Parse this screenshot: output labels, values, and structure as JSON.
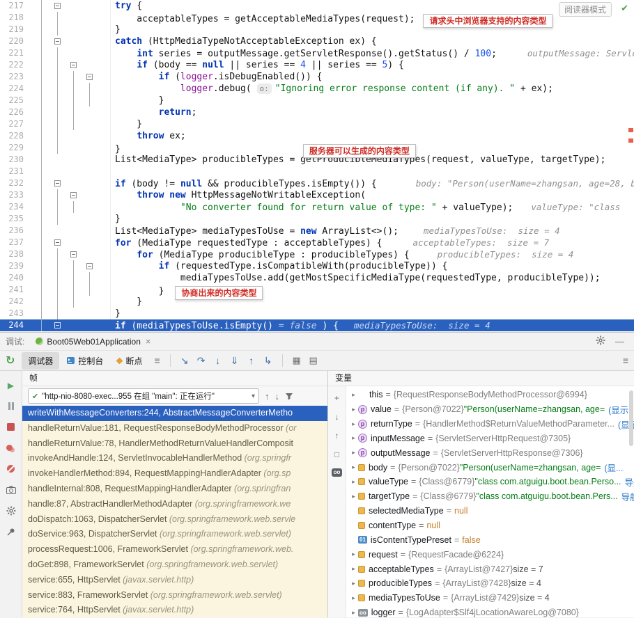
{
  "icons": {
    "rerun": "↻",
    "close": "×",
    "minimize": "—",
    "check": "✔",
    "dropdown": "▾",
    "chevron": "▸",
    "arrow_up": "↑",
    "arrow_down": "↓",
    "menu": "≡",
    "resume": "▶"
  },
  "editor": {
    "reader_mode": "阅读器模式",
    "lines": [
      {
        "n": "217",
        "g": [
          0
        ],
        "b": 1,
        "tk": [
          [
            "k",
            "try"
          ],
          [
            "d",
            " {"
          ]
        ]
      },
      {
        "n": "218",
        "g": [
          0,
          1
        ],
        "tk": [
          [
            "d",
            "    acceptableTypes = getAcceptableMediaTypes(request);"
          ]
        ],
        "ann": {
          "t": "请求头中浏览器支持的内容类型"
        }
      },
      {
        "n": "219",
        "g": [
          0,
          1
        ],
        "tk": [
          [
            "d",
            "}"
          ]
        ]
      },
      {
        "n": "220",
        "g": [
          0
        ],
        "b": 1,
        "tk": [
          [
            "k",
            "catch"
          ],
          [
            "d",
            " (HttpMediaTypeNotAcceptableException ex) {"
          ]
        ]
      },
      {
        "n": "221",
        "g": [
          0,
          1
        ],
        "tk": [
          [
            "d",
            "    "
          ],
          [
            "k",
            "int"
          ],
          [
            "d",
            " series = outputMessage.getServletResponse().getStatus() / "
          ],
          [
            "n",
            "100"
          ],
          [
            "d",
            ";"
          ]
        ],
        "hint": "outputMessage: Servle",
        "hm": 44
      },
      {
        "n": "222",
        "g": [
          0,
          1
        ],
        "b": 2,
        "tk": [
          [
            "d",
            "    "
          ],
          [
            "k",
            "if"
          ],
          [
            "d",
            " (body == "
          ],
          [
            "k",
            "null"
          ],
          [
            "d",
            " || series == "
          ],
          [
            "n",
            "4"
          ],
          [
            "d",
            " || series == "
          ],
          [
            "n",
            "5"
          ],
          [
            "d",
            ") {"
          ]
        ]
      },
      {
        "n": "223",
        "g": [
          0,
          1,
          2
        ],
        "b": 3,
        "tk": [
          [
            "d",
            "        "
          ],
          [
            "k",
            "if"
          ],
          [
            "d",
            " ("
          ],
          [
            "f",
            "logger"
          ],
          [
            "d",
            ".isDebugEnabled()) {"
          ]
        ]
      },
      {
        "n": "224",
        "g": [
          0,
          1,
          2,
          3
        ],
        "tk": [
          [
            "d",
            "            "
          ],
          [
            "f",
            "logger"
          ],
          [
            "d",
            ".debug( "
          ],
          [
            "chip",
            "o:"
          ],
          [
            "s",
            "\"Ignoring error response content (if any). \""
          ],
          [
            "d",
            " + ex);"
          ]
        ]
      },
      {
        "n": "225",
        "g": [
          0,
          1,
          2,
          3
        ],
        "tk": [
          [
            "d",
            "        }"
          ]
        ]
      },
      {
        "n": "226",
        "g": [
          0,
          1,
          2
        ],
        "tk": [
          [
            "d",
            "        "
          ],
          [
            "k",
            "return"
          ],
          [
            "d",
            ";"
          ]
        ]
      },
      {
        "n": "227",
        "g": [
          0,
          1,
          2
        ],
        "tk": [
          [
            "d",
            "    }"
          ]
        ]
      },
      {
        "n": "228",
        "g": [
          0,
          1
        ],
        "tk": [
          [
            "d",
            "    "
          ],
          [
            "k",
            "throw"
          ],
          [
            "d",
            " ex;"
          ]
        ]
      },
      {
        "n": "229",
        "g": [
          0,
          1
        ],
        "tk": [
          [
            "d",
            "}"
          ]
        ],
        "ann": {
          "t": "服务器可以生成的内容类型",
          "ml": 262
        }
      },
      {
        "n": "230",
        "g": [
          0
        ],
        "tk": [
          [
            "d",
            "List<MediaType> producibleTypes = getProducibleMediaTypes(request, valueType, targetType);"
          ]
        ]
      },
      {
        "n": "231",
        "g": [
          0
        ],
        "tk": []
      },
      {
        "n": "232",
        "g": [
          0
        ],
        "b": 1,
        "tk": [
          [
            "k",
            "if"
          ],
          [
            "d",
            " (body != "
          ],
          [
            "k",
            "null"
          ],
          [
            "d",
            " && producibleTypes.isEmpty()) {"
          ]
        ],
        "hint": "body: \"Person(userName=zhangsan, age=28, b",
        "hm": 56
      },
      {
        "n": "233",
        "g": [
          0,
          1
        ],
        "b": 2,
        "tk": [
          [
            "d",
            "    "
          ],
          [
            "k",
            "throw"
          ],
          [
            "d",
            " "
          ],
          [
            "k",
            "new"
          ],
          [
            "d",
            " HttpMessageNotWritableException("
          ]
        ]
      },
      {
        "n": "234",
        "g": [
          0,
          1,
          2
        ],
        "tk": [
          [
            "d",
            "            "
          ],
          [
            "s",
            "\"No converter found for return value of type: \""
          ],
          [
            "d",
            " + valueType);"
          ]
        ],
        "hint": "valueType: \"class",
        "hm": 26
      },
      {
        "n": "235",
        "g": [
          0,
          1
        ],
        "tk": [
          [
            "d",
            "}"
          ]
        ]
      },
      {
        "n": "236",
        "g": [
          0
        ],
        "tk": [
          [
            "d",
            "List<MediaType> mediaTypesToUse = "
          ],
          [
            "k",
            "new"
          ],
          [
            "d",
            " ArrayList<>();"
          ]
        ],
        "hint": "mediaTypesToUse:  size = 4",
        "hm": 36
      },
      {
        "n": "237",
        "g": [
          0
        ],
        "b": 1,
        "tk": [
          [
            "k",
            "for"
          ],
          [
            "d",
            " (MediaType requestedType : acceptableTypes) {"
          ]
        ],
        "hint": "acceptableTypes:  size = 7",
        "hm": 44
      },
      {
        "n": "238",
        "g": [
          0,
          1
        ],
        "b": 2,
        "tk": [
          [
            "d",
            "    "
          ],
          [
            "k",
            "for"
          ],
          [
            "d",
            " (MediaType producibleType : producibleTypes) {"
          ]
        ],
        "hint": "producibleTypes:  size = 4",
        "hm": 40
      },
      {
        "n": "239",
        "g": [
          0,
          1,
          2
        ],
        "b": 3,
        "tk": [
          [
            "d",
            "        "
          ],
          [
            "k",
            "if"
          ],
          [
            "d",
            " (requestedType.isCompatibleWith(producibleType)) {"
          ]
        ]
      },
      {
        "n": "240",
        "g": [
          0,
          1,
          2,
          3
        ],
        "tk": [
          [
            "d",
            "            mediaTypesToUse.add(getMostSpecificMediaType(requestedType, producibleType));"
          ]
        ]
      },
      {
        "n": "241",
        "g": [
          0,
          1,
          2,
          3
        ],
        "tk": [
          [
            "d",
            "        }"
          ]
        ],
        "ann": {
          "t": "协商出来的内容类型",
          "ml": 16
        }
      },
      {
        "n": "242",
        "g": [
          0,
          1,
          2
        ],
        "tk": [
          [
            "d",
            "    }"
          ]
        ]
      },
      {
        "n": "243",
        "g": [
          0,
          1
        ],
        "tk": [
          [
            "d",
            "}"
          ]
        ]
      },
      {
        "n": "244",
        "g": [
          0
        ],
        "b": 1,
        "cur": true,
        "tk": [
          [
            "k",
            "if"
          ],
          [
            "d",
            " (mediaTypesToUse.isEmpty()"
          ],
          [
            "ev",
            " = false "
          ],
          [
            "d",
            ") {"
          ]
        ],
        "hint": "mediaTypesToUse:  size = 4",
        "hm": 22
      }
    ]
  },
  "debug": {
    "title_label": "调试:",
    "session_tab": "Boot05Web01Application",
    "tabs": [
      {
        "label": "调试器"
      },
      {
        "label": "控制台"
      },
      {
        "label": "断点"
      }
    ],
    "thread": "\"http-nio-8080-exec...955 在组 \"main\": 正在运行\"",
    "frames_header": "帧",
    "vars_header": "变量",
    "steps": [
      {
        "name": "show-execution-point-button",
        "glyph": "↘"
      },
      {
        "name": "step-over-button",
        "glyph": "↷"
      },
      {
        "name": "step-into-button",
        "glyph": "↓"
      },
      {
        "name": "force-step-into-button",
        "glyph": "⇓"
      },
      {
        "name": "step-out-button",
        "glyph": "↑"
      },
      {
        "name": "run-to-cursor-button",
        "glyph": "↳"
      }
    ],
    "tools": [
      {
        "name": "evaluate-expression-button",
        "glyph": "▦"
      },
      {
        "name": "layout-settings-button",
        "glyph": "▤"
      }
    ],
    "left_toolbar": [
      {
        "name": "resume-button",
        "kind": "play"
      },
      {
        "name": "pause-button",
        "kind": "pause"
      },
      {
        "name": "stop-button",
        "kind": "stop"
      },
      {
        "name": "view-breakpoints-button",
        "kind": "bp2"
      },
      {
        "name": "mute-breakpoints-button",
        "kind": "bpmute"
      },
      {
        "name": "thread-dump-button",
        "kind": "camera"
      },
      {
        "name": "settings-button",
        "kind": "gear"
      },
      {
        "name": "pin-button",
        "kind": "pin"
      }
    ],
    "var_toolbar": [
      {
        "name": "add-watch-button",
        "glyph": "+"
      },
      {
        "name": "arrow-down-icon",
        "glyph": "↓"
      },
      {
        "name": "arrow-up-icon",
        "glyph": "↑"
      },
      {
        "name": "copy-icon",
        "glyph": "□"
      },
      {
        "name": "endless-loop-badge",
        "glyph": "oo",
        "kind": "badge"
      }
    ],
    "frames": [
      {
        "t": "writeWithMessageConverters:244, AbstractMessageConverterMetho",
        "p": "",
        "sel": true
      },
      {
        "t": "handleReturnValue:181, RequestResponseBodyMethodProcessor ",
        "p": "(or"
      },
      {
        "t": "handleReturnValue:78, HandlerMethodReturnValueHandlerComposit",
        "p": ""
      },
      {
        "t": "invokeAndHandle:124, ServletInvocableHandlerMethod ",
        "p": "(org.springfr"
      },
      {
        "t": "invokeHandlerMethod:894, RequestMappingHandlerAdapter ",
        "p": "(org.sp"
      },
      {
        "t": "handleInternal:808, RequestMappingHandlerAdapter ",
        "p": "(org.springfran"
      },
      {
        "t": "handle:87, AbstractHandlerMethodAdapter ",
        "p": "(org.springframework.we"
      },
      {
        "t": "doDispatch:1063, DispatcherServlet ",
        "p": "(org.springframework.web.servle"
      },
      {
        "t": "doService:963, DispatcherServlet ",
        "p": "(org.springframework.web.servlet)"
      },
      {
        "t": "processRequest:1006, FrameworkServlet ",
        "p": "(org.springframework.web."
      },
      {
        "t": "doGet:898, FrameworkServlet ",
        "p": "(org.springframework.web.servlet)"
      },
      {
        "t": "service:655, HttpServlet ",
        "p": "(javax.servlet.http)"
      },
      {
        "t": "service:883, FrameworkServlet ",
        "p": "(org.springframework.web.servlet)"
      },
      {
        "t": "service:764, HttpServlet ",
        "p": "(javax.servlet.http)"
      }
    ],
    "variables": [
      {
        "exp": true,
        "icon": "",
        "name": "this",
        "parts": [
          [
            "ref",
            "{RequestResponseBodyMethodProcessor@6994}"
          ]
        ]
      },
      {
        "exp": true,
        "icon": "p",
        "name": "value",
        "parts": [
          [
            "ref",
            "{Person@7022} "
          ],
          [
            "str",
            "\"Person(userName=zhangsan, age="
          ]
        ],
        "link": "(显示..."
      },
      {
        "exp": true,
        "icon": "p",
        "name": "returnType",
        "parts": [
          [
            "ref",
            "{HandlerMethod$ReturnValueMethodParameter..."
          ]
        ],
        "link": "(显示..."
      },
      {
        "exp": true,
        "icon": "p",
        "name": "inputMessage",
        "parts": [
          [
            "ref",
            "{ServletServerHttpRequest@7305}"
          ]
        ]
      },
      {
        "exp": true,
        "icon": "p",
        "name": "outputMessage",
        "parts": [
          [
            "ref",
            "{ServletServerHttpResponse@7306}"
          ]
        ]
      },
      {
        "exp": true,
        "icon": "v",
        "name": "body",
        "parts": [
          [
            "ref",
            "{Person@7022} "
          ],
          [
            "str",
            "\"Person(userName=zhangsan, age="
          ]
        ],
        "link": "(显..."
      },
      {
        "exp": true,
        "icon": "v",
        "name": "valueType",
        "parts": [
          [
            "ref",
            "{Class@6779} "
          ],
          [
            "str",
            "\"class com.atguigu.boot.bean.Perso..."
          ]
        ],
        "link": "导航"
      },
      {
        "exp": true,
        "icon": "v",
        "name": "targetType",
        "parts": [
          [
            "ref",
            "{Class@6779} "
          ],
          [
            "str",
            "\"class com.atguigu.boot.bean.Pers..."
          ]
        ],
        "link": "导航"
      },
      {
        "exp": false,
        "icon": "v",
        "name": "selectedMediaType",
        "parts": [
          [
            "kw",
            "null"
          ]
        ]
      },
      {
        "exp": false,
        "icon": "v",
        "name": "contentType",
        "parts": [
          [
            "kw",
            "null"
          ]
        ]
      },
      {
        "exp": false,
        "icon": "01",
        "name": "isContentTypePreset",
        "parts": [
          [
            "kw",
            "false"
          ]
        ]
      },
      {
        "exp": true,
        "icon": "v",
        "name": "request",
        "parts": [
          [
            "ref",
            "{RequestFacade@6224}"
          ]
        ]
      },
      {
        "exp": true,
        "icon": "v",
        "name": "acceptableTypes",
        "parts": [
          [
            "ref",
            "{ArrayList@7427} "
          ],
          [
            "size",
            "size = 7"
          ]
        ]
      },
      {
        "exp": true,
        "icon": "v",
        "name": "producibleTypes",
        "parts": [
          [
            "ref",
            "{ArrayList@7428} "
          ],
          [
            "size",
            "size = 4"
          ]
        ]
      },
      {
        "exp": true,
        "icon": "v",
        "name": "mediaTypesToUse",
        "parts": [
          [
            "ref",
            "{ArrayList@7429} "
          ],
          [
            "size",
            "size = 4"
          ]
        ]
      },
      {
        "exp": true,
        "icon": "oo",
        "name": "logger",
        "parts": [
          [
            "ref",
            "{LogAdapter$Slf4jLocationAwareLog@7080}"
          ]
        ]
      }
    ]
  }
}
